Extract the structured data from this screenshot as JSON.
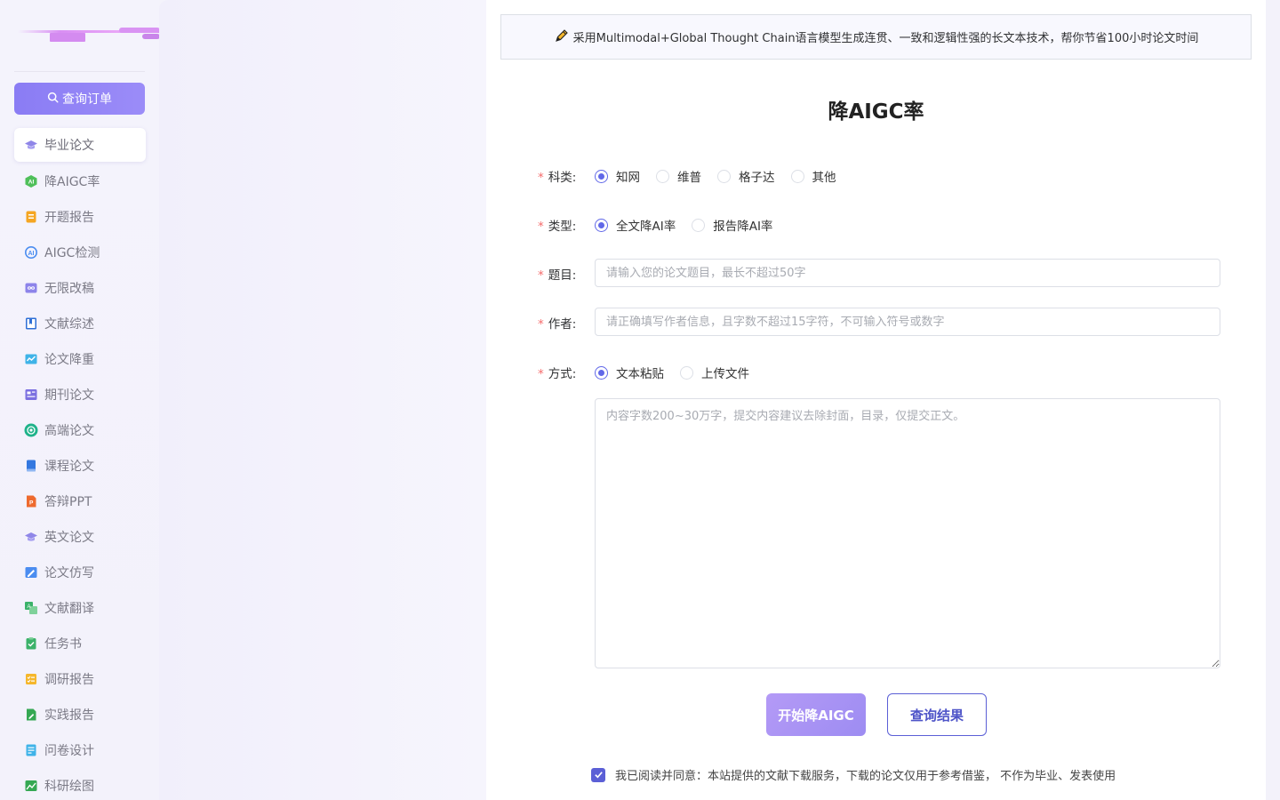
{
  "sidebar": {
    "query_button": "查询订单",
    "items": [
      {
        "label": "毕业论文",
        "icon": "graduation-cap-icon",
        "active": true
      },
      {
        "label": "降AIGC率",
        "icon": "ai-badge-icon"
      },
      {
        "label": "开题报告",
        "icon": "report-doc-icon"
      },
      {
        "label": "AIGC检测",
        "icon": "ai-detect-icon"
      },
      {
        "label": "无限改稿",
        "icon": "infinity-icon"
      },
      {
        "label": "文献综述",
        "icon": "book-bookmark-icon"
      },
      {
        "label": "论文降重",
        "icon": "trend-chart-icon"
      },
      {
        "label": "期刊论文",
        "icon": "journal-icon"
      },
      {
        "label": "高端论文",
        "icon": "openai-logo-icon"
      },
      {
        "label": "课程论文",
        "icon": "course-book-icon"
      },
      {
        "label": "答辩PPT",
        "icon": "ppt-icon"
      },
      {
        "label": "英文论文",
        "icon": "graduation-cap-icon"
      },
      {
        "label": "论文仿写",
        "icon": "edit-image-icon"
      },
      {
        "label": "文献翻译",
        "icon": "translate-icon"
      },
      {
        "label": "任务书",
        "icon": "task-check-icon"
      },
      {
        "label": "调研报告",
        "icon": "survey-list-icon"
      },
      {
        "label": "实践报告",
        "icon": "practice-doc-icon"
      },
      {
        "label": "问卷设计",
        "icon": "questionnaire-icon"
      },
      {
        "label": "科研绘图",
        "icon": "image-chart-icon"
      }
    ]
  },
  "notice": "采用Multimodal+Global Thought Chain语言模型生成连贯、一致和逻辑性强的长文本技术，帮你节省100小时论文时间",
  "page_title": "降AIGC率",
  "form": {
    "subject": {
      "label": "科类:",
      "options": [
        "知网",
        "维普",
        "格子达",
        "其他"
      ],
      "selected": "知网"
    },
    "type": {
      "label": "类型:",
      "options": [
        "全文降AI率",
        "报告降AI率"
      ],
      "selected": "全文降AI率"
    },
    "title": {
      "label": "题目:",
      "placeholder": "请输入您的论文题目，最长不超过50字"
    },
    "author": {
      "label": "作者:",
      "placeholder": "请正确填写作者信息，且字数不超过15字符，不可输入符号或数字"
    },
    "method": {
      "label": "方式:",
      "options": [
        "文本粘贴",
        "上传文件"
      ],
      "selected": "文本粘贴"
    },
    "content": {
      "placeholder": "内容字数200~30万字，提交内容建议去除封面，目录，仅提交正文。"
    },
    "start_button": "开始降AIGC",
    "result_button": "查询结果",
    "agreement": "我已阅读并同意：本站提供的文献下载服务，下载的论文仅用于参考借鉴， 不作为毕业、发表使用",
    "agreement_checked": true
  },
  "colors": {
    "accent": "#6168e8",
    "button_gradient_start": "#8a7cf4",
    "required": "#f56c6c"
  }
}
